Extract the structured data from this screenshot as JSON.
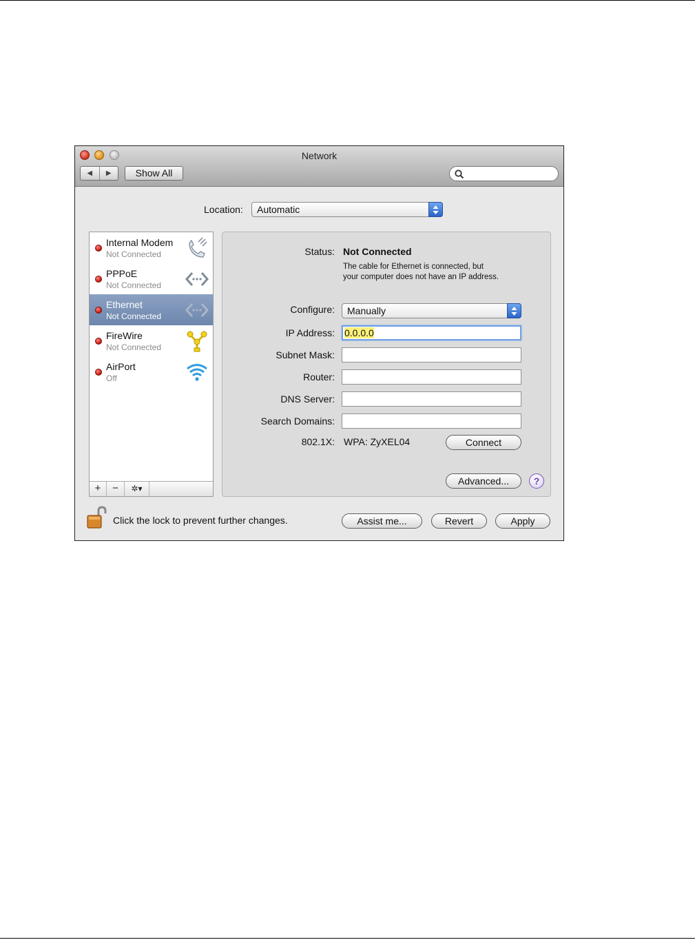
{
  "window": {
    "title": "Network"
  },
  "toolbar": {
    "back": "◀",
    "forward": "▶",
    "show_all": "Show All",
    "search_placeholder": ""
  },
  "location": {
    "label": "Location:",
    "value": "Automatic"
  },
  "services": [
    {
      "name": "Internal Modem",
      "status": "Not Connected",
      "icon": "modem-icon",
      "selected": false
    },
    {
      "name": "PPPoE",
      "status": "Not Connected",
      "icon": "ethernet-arrows-icon",
      "selected": false
    },
    {
      "name": "Ethernet",
      "status": "Not Connected",
      "icon": "ethernet-arrows-icon",
      "selected": true
    },
    {
      "name": "FireWire",
      "status": "Not Connected",
      "icon": "firewire-icon",
      "selected": false
    },
    {
      "name": "AirPort",
      "status": "Off",
      "icon": "wifi-icon",
      "selected": false
    }
  ],
  "sidebar_toolbar": {
    "add": "+",
    "remove": "−",
    "action": "✲▾"
  },
  "details": {
    "status_label": "Status:",
    "status_value": "Not Connected",
    "status_desc_1": "The cable for Ethernet is connected, but",
    "status_desc_2": "your computer does not have an IP address.",
    "configure_label": "Configure:",
    "configure_value": "Manually",
    "ip_label": "IP Address:",
    "ip_value": "0.0.0.0",
    "subnet_label": "Subnet Mask:",
    "subnet_value": "",
    "router_label": "Router:",
    "router_value": "",
    "dns_label": "DNS Server:",
    "dns_value": "",
    "search_domains_label": "Search Domains:",
    "search_domains_value": "",
    "dot1x_label": "802.1X:",
    "dot1x_value": "WPA: ZyXEL04",
    "connect_button": "Connect",
    "advanced_button": "Advanced...",
    "help_button": "?"
  },
  "footer": {
    "lock_text": "Click the lock to prevent further changes.",
    "assist_button": "Assist me...",
    "revert_button": "Revert",
    "apply_button": "Apply"
  },
  "colors": {
    "selected_row": "#7b90b6",
    "status_red": "#d11a0f",
    "focus_ring": "#6fa0e8",
    "ip_highlight": "#fff17a"
  }
}
